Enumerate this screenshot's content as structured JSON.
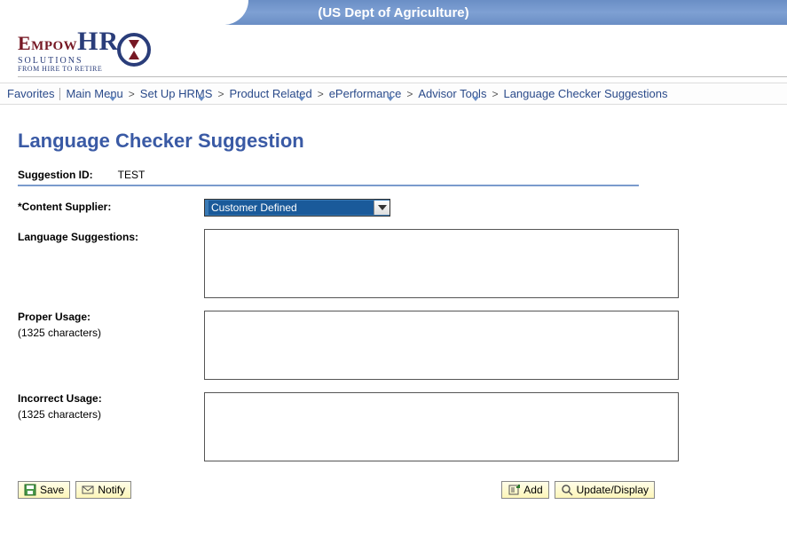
{
  "banner": {
    "org_name": "(US Dept of Agriculture)"
  },
  "logo": {
    "name": "EmpowHR",
    "sub1": "SOLUTIONS",
    "sub2": "FROM HIRE TO RETIRE"
  },
  "breadcrumb": {
    "favorites": "Favorites",
    "items": [
      "Main Menu",
      "Set Up HRMS",
      "Product Related",
      "ePerformance",
      "Advisor Tools",
      "Language Checker Suggestions"
    ]
  },
  "page": {
    "title": "Language Checker Suggestion",
    "suggestion_id_label": "Suggestion ID:",
    "suggestion_id_value": "TEST",
    "content_supplier_label": "*Content Supplier:",
    "content_supplier_value": "Customer Defined",
    "language_suggestions_label": "Language Suggestions:",
    "language_suggestions_value": "",
    "proper_usage_label": "Proper Usage:",
    "proper_usage_hint": "(1325 characters)",
    "proper_usage_value": "",
    "incorrect_usage_label": "Incorrect Usage:",
    "incorrect_usage_hint": "(1325 characters)",
    "incorrect_usage_value": ""
  },
  "buttons": {
    "save": "Save",
    "notify": "Notify",
    "add": "Add",
    "update_display": "Update/Display"
  }
}
